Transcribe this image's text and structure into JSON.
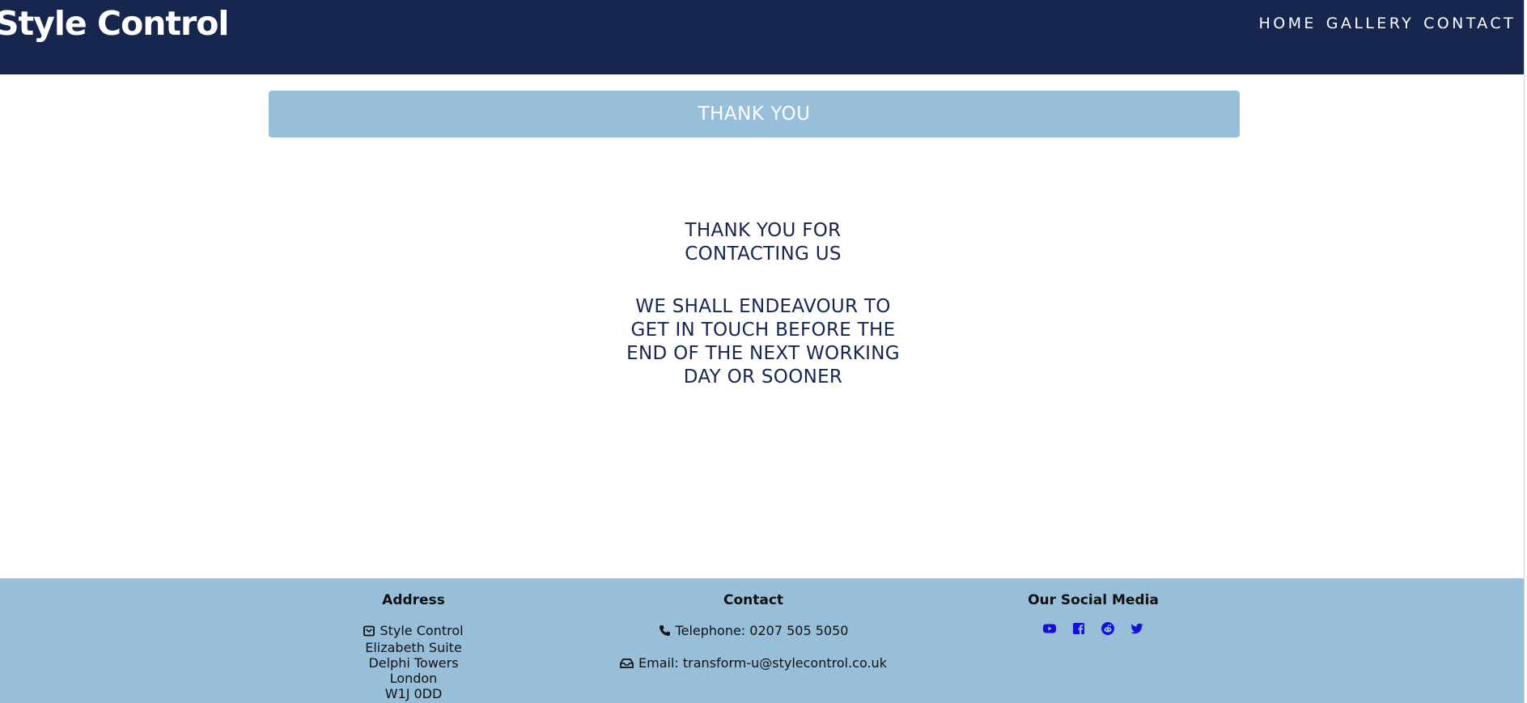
{
  "header": {
    "logo": "Style Control",
    "nav": [
      "HOME",
      "GALLERY",
      "CONTACT"
    ]
  },
  "banner": {
    "title": "THANK YOU"
  },
  "message": {
    "line1": [
      "THANK YOU FOR",
      "CONTACTING US"
    ],
    "line2": [
      "WE SHALL ENDEAVOUR TO",
      "GET IN TOUCH BEFORE THE",
      "END OF THE NEXT WORKING",
      "DAY OR SOONER"
    ]
  },
  "footer": {
    "address": {
      "heading": "Address",
      "lines": [
        "Style Control",
        "Elizabeth Suite",
        "Delphi Towers",
        "London",
        "W1J 0DD"
      ]
    },
    "contact": {
      "heading": "Contact",
      "telephone": "Telephone: 0207 505 5050",
      "email": "Email: transform-u@stylecontrol.co.uk"
    },
    "social": {
      "heading": "Our Social Media",
      "icons": [
        "youtube-icon",
        "facebook-icon",
        "reddit-icon",
        "twitter-icon"
      ],
      "icon_color": "#1a0dd6"
    }
  },
  "colors": {
    "header_bg": "#17264f",
    "banner_bg": "#98bfd9",
    "footer_bg": "#98bfd9",
    "text_dark": "#17264f"
  }
}
